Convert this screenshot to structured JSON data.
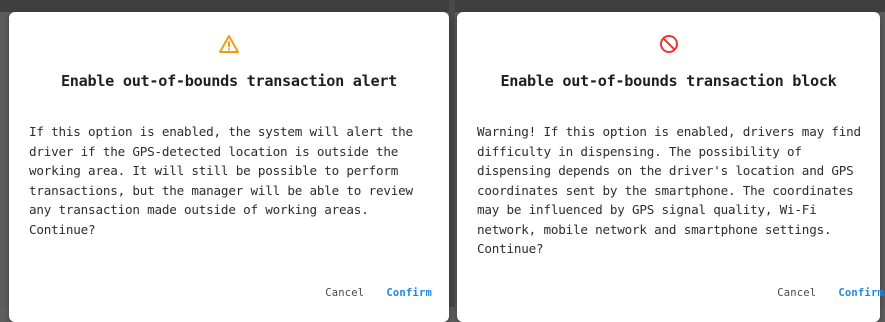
{
  "theme": {
    "warning_color": "#f39c12",
    "block_color": "#e53935",
    "confirm_color": "#1e88e5"
  },
  "dialogs": [
    {
      "icon": "warning-triangle-icon",
      "title": "Enable out-of-bounds transaction alert",
      "body": "If this option is enabled, the system will alert the driver if the GPS-detected location is outside the working area. It will still be possible to perform transactions, but the manager will be able to review any transaction made outside of working areas. Continue?",
      "cancel_label": "Cancel",
      "confirm_label": "Confirm"
    },
    {
      "icon": "block-prohibited-icon",
      "title": "Enable out-of-bounds transaction block",
      "body": "Warning! If this option is enabled, drivers may find difficulty in dispensing. The possibility of dispensing depends on the driver's location and GPS coordinates sent by the smartphone. The coordinates may be influenced by GPS signal quality, Wi-Fi network, mobile network and smartphone settings. Continue?",
      "cancel_label": "Cancel",
      "confirm_label": "Confirm"
    }
  ]
}
